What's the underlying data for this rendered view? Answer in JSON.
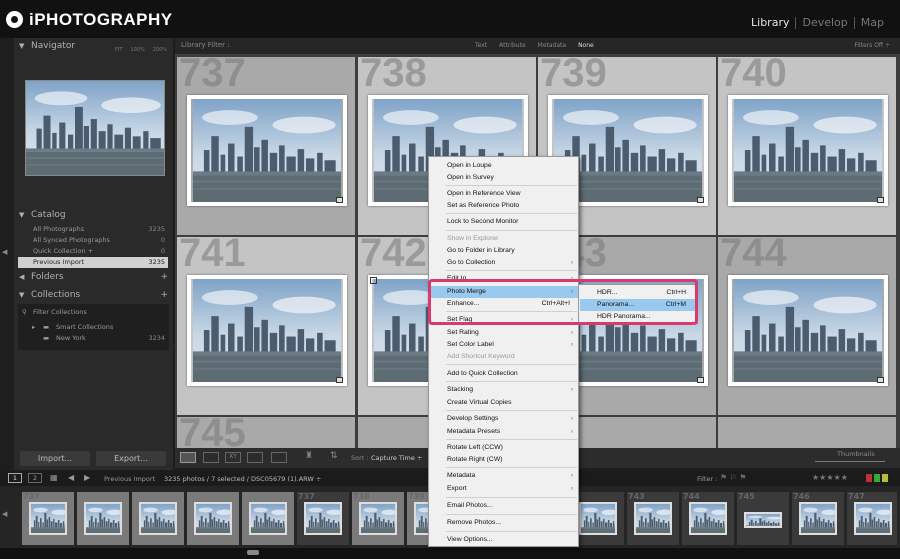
{
  "app": {
    "brand": "iPHOTOGRAPHY"
  },
  "modules": [
    "Library",
    "Develop",
    "Map"
  ],
  "navigator": {
    "title": "Navigator",
    "options": [
      "FIT",
      "100%",
      "200%"
    ]
  },
  "catalog": {
    "title": "Catalog",
    "rows": [
      {
        "label": "All Photographs",
        "count": "3235"
      },
      {
        "label": "All Synced Photographs",
        "count": "0"
      },
      {
        "label": "Quick Collection +",
        "count": "0"
      },
      {
        "label": "Previous Import",
        "count": "3235"
      }
    ]
  },
  "folders": {
    "title": "Folders"
  },
  "collections": {
    "title": "Collections",
    "filter": "Filter Collections",
    "items": [
      {
        "label": "Smart Collections",
        "count": ""
      },
      {
        "label": "New York",
        "count": "3234"
      }
    ]
  },
  "buttons": {
    "import": "Import...",
    "export": "Export..."
  },
  "filter_bar": {
    "label": "Library Filter :",
    "options": [
      "Text",
      "Attribute",
      "Metadata",
      "None"
    ],
    "right": "Filters Off ÷"
  },
  "grid": {
    "numbers": [
      "737",
      "738",
      "739",
      "740",
      "741",
      "742",
      "743",
      "744",
      "745"
    ]
  },
  "toolbar": {
    "sort_label": "Sort :",
    "sort_value": "Capture Time ÷",
    "thumbnails": "Thumbnails"
  },
  "strip_bar": {
    "pages": [
      "1",
      "2"
    ],
    "source": "Previous Import",
    "info": "3235 photos / 7 selected / DSC05679 (1).ARW ÷",
    "filter": "Filter :"
  },
  "filmstrip": {
    "numbers": [
      "737",
      "",
      "",
      "",
      "",
      "737",
      "738",
      "739",
      "",
      "",
      "",
      "743",
      "744",
      "745",
      "746",
      "747"
    ]
  },
  "context_menu": {
    "items": [
      {
        "label": "Open in Loupe",
        "shortcut": "",
        "arrow": false,
        "disabled": false
      },
      {
        "label": "Open in Survey",
        "shortcut": "",
        "arrow": false,
        "disabled": false
      },
      {
        "label": "Open in Reference View",
        "shortcut": "",
        "arrow": false,
        "disabled": false
      },
      {
        "label": "Set as Reference Photo",
        "shortcut": "",
        "arrow": false,
        "disabled": false
      },
      {
        "label": "Lock to Second Monitor",
        "shortcut": "",
        "arrow": false,
        "disabled": false
      },
      {
        "label": "Show in Explorer",
        "shortcut": "",
        "arrow": false,
        "disabled": true
      },
      {
        "label": "Go to Folder in Library",
        "shortcut": "",
        "arrow": false,
        "disabled": false
      },
      {
        "label": "Go to Collection",
        "shortcut": "",
        "arrow": true,
        "disabled": false
      },
      {
        "label": "Edit In",
        "shortcut": "",
        "arrow": true,
        "disabled": false
      },
      {
        "label": "Photo Merge",
        "shortcut": "",
        "arrow": true,
        "disabled": false
      },
      {
        "label": "Enhance...",
        "shortcut": "Ctrl+Alt+I",
        "arrow": false,
        "disabled": false
      },
      {
        "label": "Set Flag",
        "shortcut": "",
        "arrow": true,
        "disabled": false
      },
      {
        "label": "Set Rating",
        "shortcut": "",
        "arrow": true,
        "disabled": false
      },
      {
        "label": "Set Color Label",
        "shortcut": "",
        "arrow": true,
        "disabled": false
      },
      {
        "label": "Add Shortcut Keyword",
        "shortcut": "",
        "arrow": false,
        "disabled": true
      },
      {
        "label": "Add to Quick Collection",
        "shortcut": "",
        "arrow": false,
        "disabled": false
      },
      {
        "label": "Stacking",
        "shortcut": "",
        "arrow": true,
        "disabled": false
      },
      {
        "label": "Create Virtual Copies",
        "shortcut": "",
        "arrow": false,
        "disabled": false
      },
      {
        "label": "Develop Settings",
        "shortcut": "",
        "arrow": true,
        "disabled": false
      },
      {
        "label": "Metadata Presets",
        "shortcut": "",
        "arrow": true,
        "disabled": false
      },
      {
        "label": "Rotate Left (CCW)",
        "shortcut": "",
        "arrow": false,
        "disabled": false
      },
      {
        "label": "Rotate Right (CW)",
        "shortcut": "",
        "arrow": false,
        "disabled": false
      },
      {
        "label": "Metadata",
        "shortcut": "",
        "arrow": true,
        "disabled": false
      },
      {
        "label": "Export",
        "shortcut": "",
        "arrow": true,
        "disabled": false
      },
      {
        "label": "Email Photos...",
        "shortcut": "",
        "arrow": false,
        "disabled": false
      },
      {
        "label": "Remove Photos...",
        "shortcut": "",
        "arrow": false,
        "disabled": false
      },
      {
        "label": "View Options...",
        "shortcut": "",
        "arrow": false,
        "disabled": false
      }
    ]
  },
  "submenu": {
    "items": [
      {
        "label": "HDR...",
        "shortcut": "Ctrl+H"
      },
      {
        "label": "Panorama...",
        "shortcut": "Ctrl+M"
      },
      {
        "label": "HDR Panorama...",
        "shortcut": ""
      }
    ]
  },
  "colors": {
    "highlight": "#d83a6e",
    "menu_hover": "#99c9ef"
  }
}
